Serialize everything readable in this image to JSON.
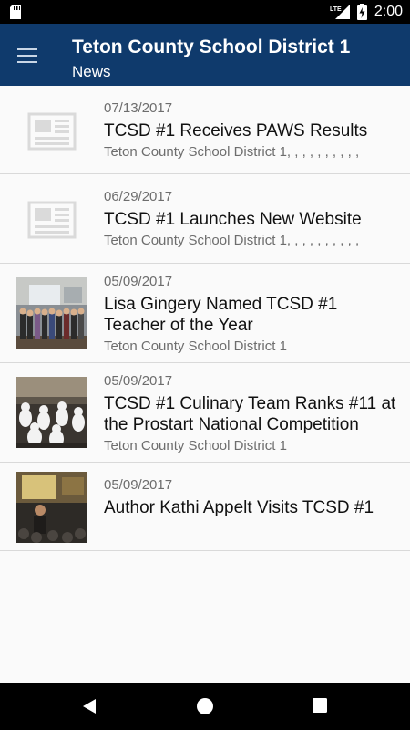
{
  "status_bar": {
    "network_label": "LTE",
    "time": "2:00"
  },
  "app_bar": {
    "title": "Teton County School District 1",
    "subtitle": "News",
    "menu_icon": "hamburger-menu-icon",
    "background_color": "#0f3a6c"
  },
  "news": [
    {
      "date": "07/13/2017",
      "headline": "TCSD #1 Receives PAWS Results",
      "source": "Teton County School District 1, , , , , , , , , ,",
      "image": "newspaper-placeholder-icon"
    },
    {
      "date": "06/29/2017",
      "headline": "TCSD #1 Launches New Website",
      "source": "Teton County School District 1, , , , , , , , , ,",
      "image": "newspaper-placeholder-icon"
    },
    {
      "date": "05/09/2017",
      "headline": "Lisa Gingery Named TCSD #1 Teacher of the Year",
      "source": "Teton County School District 1",
      "image": "group-photo-thumbnail"
    },
    {
      "date": "05/09/2017",
      "headline": "TCSD #1 Culinary Team Ranks #11 at the Prostart National Competition",
      "source": "Teton County School District 1",
      "image": "culinary-photo-thumbnail"
    },
    {
      "date": "05/09/2017",
      "headline": "Author Kathi Appelt Visits TCSD #1",
      "source": "",
      "image": "author-visit-photo-thumbnail"
    }
  ],
  "nav_bar": {
    "back": "back-triangle-icon",
    "home": "home-circle-icon",
    "recents": "recents-square-icon"
  }
}
